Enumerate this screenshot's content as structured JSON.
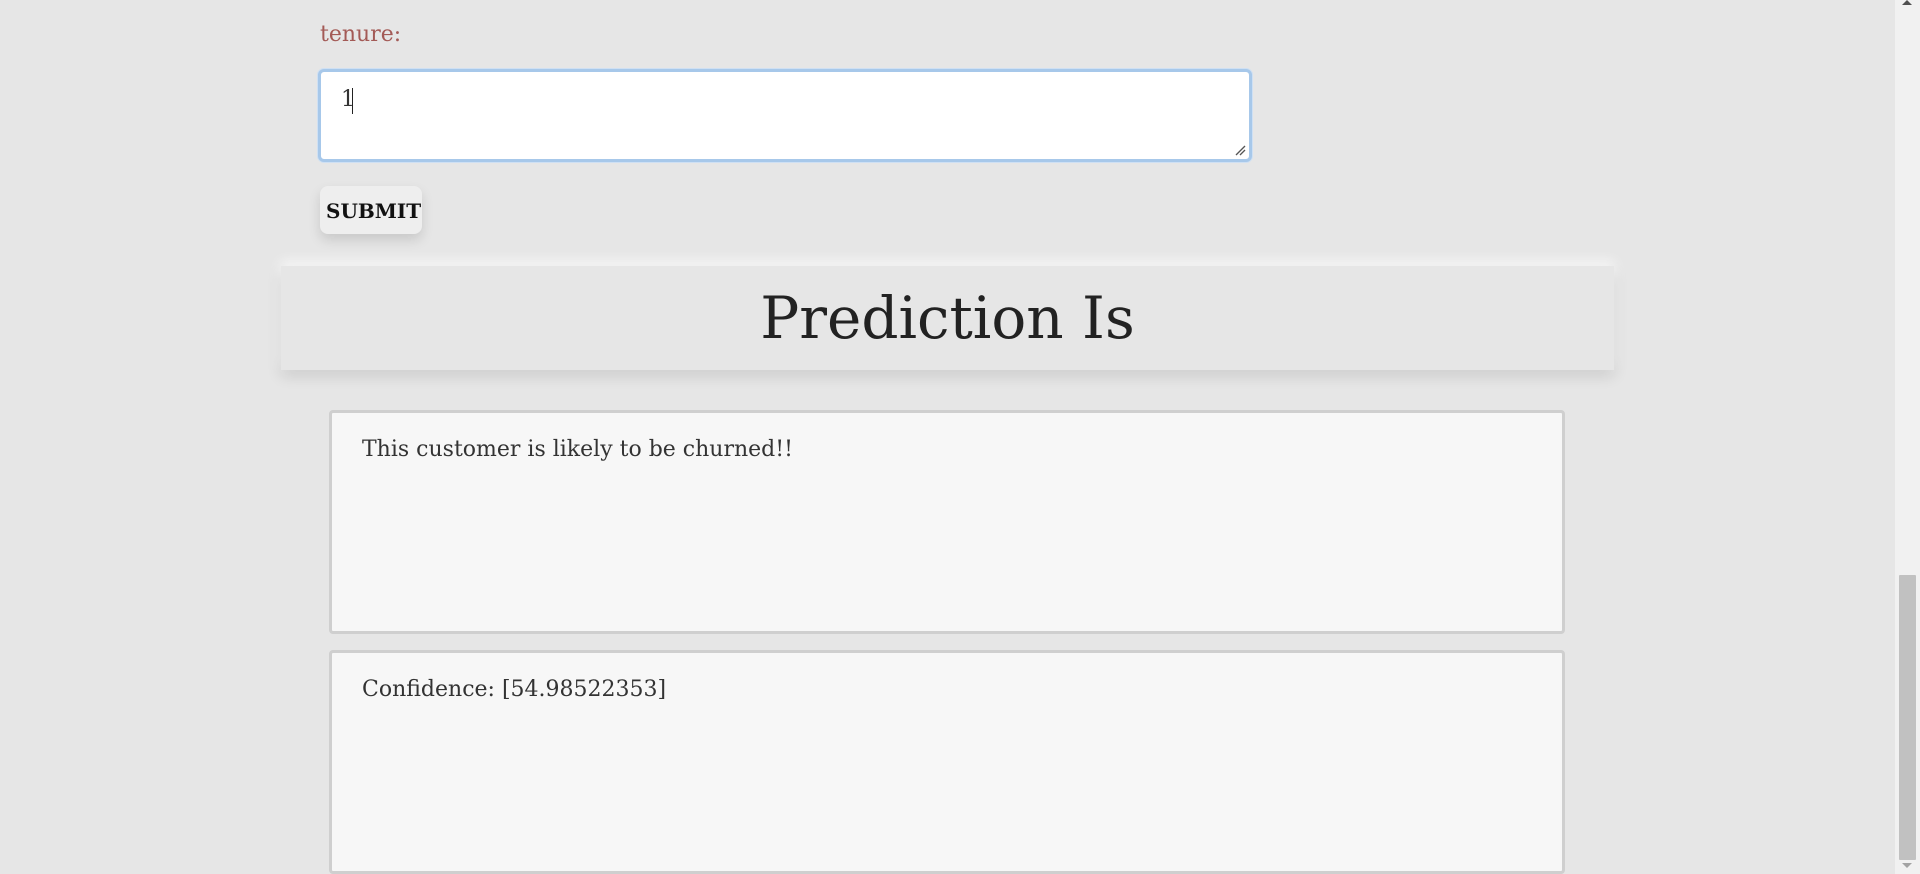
{
  "form": {
    "tenure_label": "tenure:",
    "tenure_value": "1",
    "submit_label": "SUBMIT"
  },
  "prediction": {
    "title": "Prediction Is",
    "result_text": "This customer is likely to be churned!!",
    "confidence_text": "Confidence: [54.98522353]"
  },
  "colors": {
    "background": "#e6e6e6",
    "label": "#a35a56",
    "input_focus_border": "#a7c8ea"
  },
  "icons": {
    "resize_grip": "resize-grip-icon",
    "scroll_up": "chevron-up-icon",
    "scroll_down": "chevron-down-icon"
  }
}
